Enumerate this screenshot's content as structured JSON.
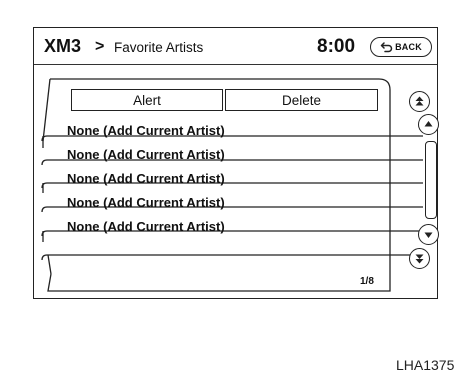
{
  "header": {
    "title": "XM3",
    "separator": ">",
    "subtitle": "Favorite Artists",
    "clock": "8:00",
    "back_label": "BACK"
  },
  "buttons": {
    "alert_label": "Alert",
    "delete_label": "Delete"
  },
  "list": {
    "items": [
      {
        "label": "None (Add Current Artist)"
      },
      {
        "label": "None (Add Current Artist)"
      },
      {
        "label": "None (Add Current Artist)"
      },
      {
        "label": "None (Add Current Artist)"
      },
      {
        "label": "None (Add Current Artist)"
      }
    ],
    "page_indicator": "1/8"
  },
  "scroll": {
    "icons": [
      "page-up-icon",
      "line-up-icon",
      "line-down-icon",
      "page-down-icon"
    ]
  },
  "figure_id": "LHA1375",
  "colors": {
    "line": "#222222",
    "background": "#ffffff",
    "text": "#111111"
  }
}
